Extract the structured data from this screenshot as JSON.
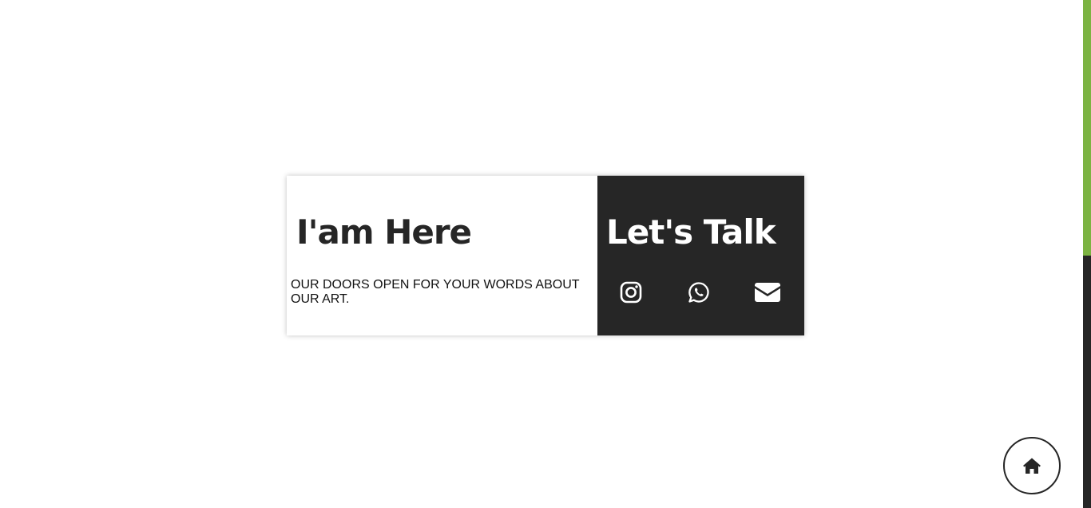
{
  "card": {
    "left": {
      "heading": "I'am Here",
      "text": "OUR DOORS OPEN FOR YOUR WORDS ABOUT OUR ART."
    },
    "right": {
      "heading": "Let's Talk",
      "socials": [
        "instagram-icon",
        "whatsapp-icon",
        "envelope-icon"
      ]
    }
  },
  "home_button": {
    "icon": "home-icon"
  },
  "colors": {
    "dark": "#262626",
    "accent": "#7cb342",
    "background": "#ffffff"
  }
}
